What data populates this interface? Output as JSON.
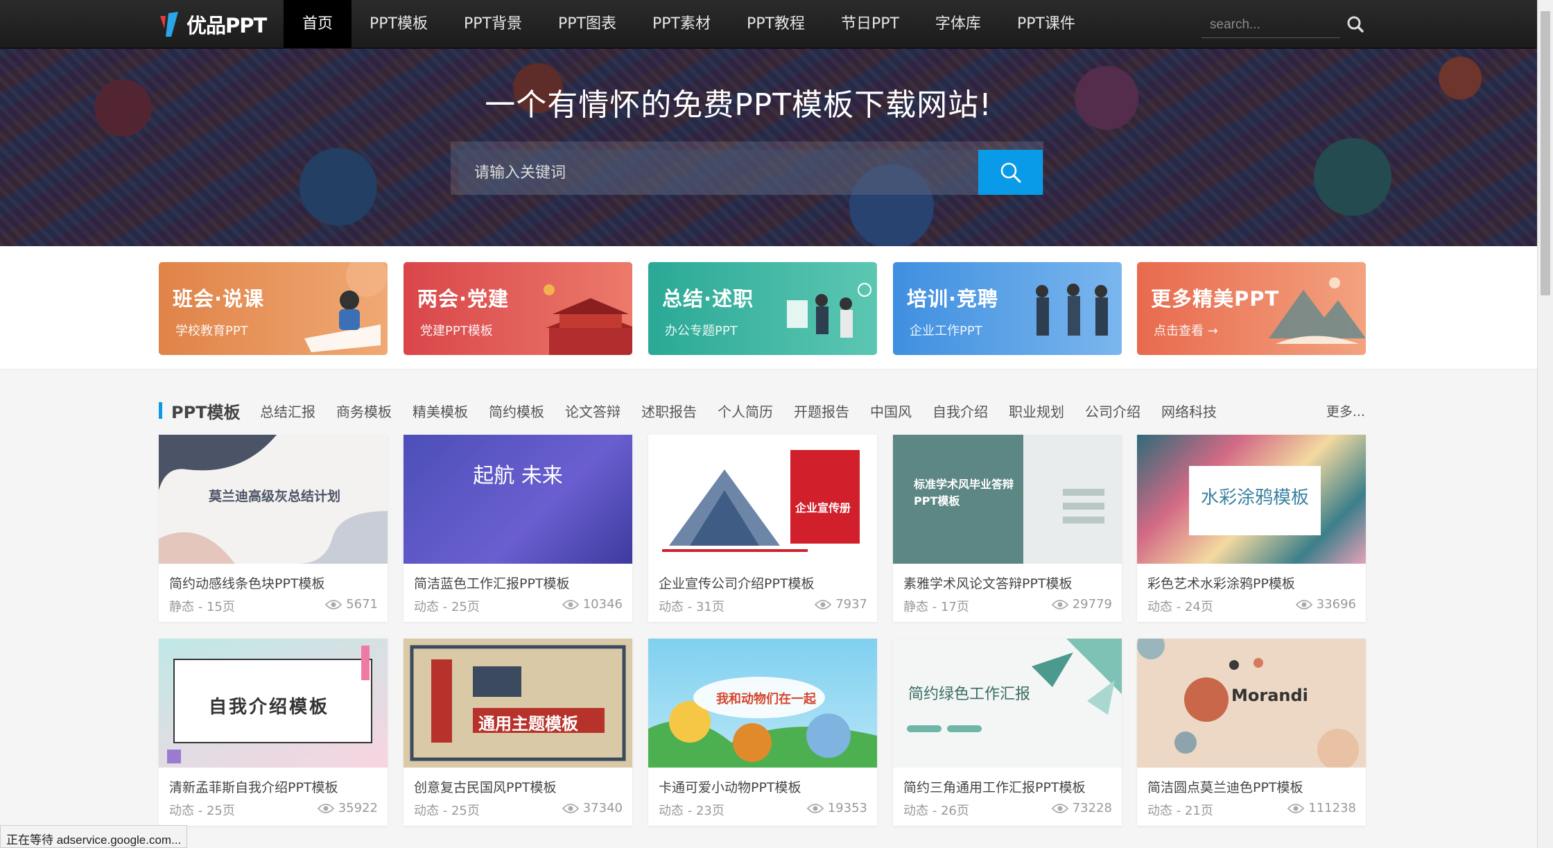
{
  "nav": {
    "logo_text": "优品PPT",
    "items": [
      "首页",
      "PPT模板",
      "PPT背景",
      "PPT图表",
      "PPT素材",
      "PPT教程",
      "节日PPT",
      "字体库",
      "PPT课件"
    ],
    "search_placeholder": "search..."
  },
  "hero": {
    "title": "一个有情怀的免费PPT模板下载网站!",
    "search_placeholder": "请输入关键词"
  },
  "categories": [
    {
      "title": "班会·说课",
      "sub": "学校教育PPT",
      "color": "#e58e52"
    },
    {
      "title": "两会·党建",
      "sub": "党建PPT模板",
      "color": "#e05a52"
    },
    {
      "title": "总结·述职",
      "sub": "办公专题PPT",
      "color": "#3fb6a3"
    },
    {
      "title": "培训·竞聘",
      "sub": "企业工作PPT",
      "color": "#5a9ee0"
    },
    {
      "title": "更多精美PPT",
      "sub": "点击查看 →",
      "color": "#ec7b5e"
    }
  ],
  "section": {
    "title": "PPT模板",
    "tags": [
      "总结汇报",
      "商务模板",
      "精美模板",
      "简约模板",
      "论文答辩",
      "述职报告",
      "个人简历",
      "开题报告",
      "中国风",
      "自我介绍",
      "职业规划",
      "公司介绍",
      "网络科技"
    ],
    "more": "更多..."
  },
  "templates": [
    {
      "title": "简约动感线条色块PPT模板",
      "meta": "静态 - 15页",
      "views": "5671",
      "thumb_text": "莫兰迪高级灰总结计划"
    },
    {
      "title": "简洁蓝色工作汇报PPT模板",
      "meta": "动态 - 25页",
      "views": "10346",
      "thumb_text": "起航 未来"
    },
    {
      "title": "企业宣传公司介绍PPT模板",
      "meta": "动态 - 31页",
      "views": "7937",
      "thumb_text": "企业宣传册"
    },
    {
      "title": "素雅学术风论文答辩PPT模板",
      "meta": "静态 - 17页",
      "views": "29779",
      "thumb_text": "标准学术风毕业答辩PPT模板"
    },
    {
      "title": "彩色艺术水彩涂鸦PP模板",
      "meta": "动态 - 24页",
      "views": "33696",
      "thumb_text": "水彩涂鸦模板"
    },
    {
      "title": "清新孟菲斯自我介绍PPT模板",
      "meta": "动态 - 25页",
      "views": "35922",
      "thumb_text": "自我介绍模板"
    },
    {
      "title": "创意复古民国风PPT模板",
      "meta": "动态 - 25页",
      "views": "37340",
      "thumb_text": "通用主题模板"
    },
    {
      "title": "卡通可爱小动物PPT模板",
      "meta": "动态 - 23页",
      "views": "19353",
      "thumb_text": "我和动物们在一起"
    },
    {
      "title": "简约三角通用工作汇报PPT模板",
      "meta": "动态 - 26页",
      "views": "73228",
      "thumb_text": "简约绿色工作汇报"
    },
    {
      "title": "简洁圆点莫兰迪色PPT模板",
      "meta": "动态 - 21页",
      "views": "111238",
      "thumb_text": "Morandi"
    }
  ],
  "status": "正在等待 adservice.google.com..."
}
